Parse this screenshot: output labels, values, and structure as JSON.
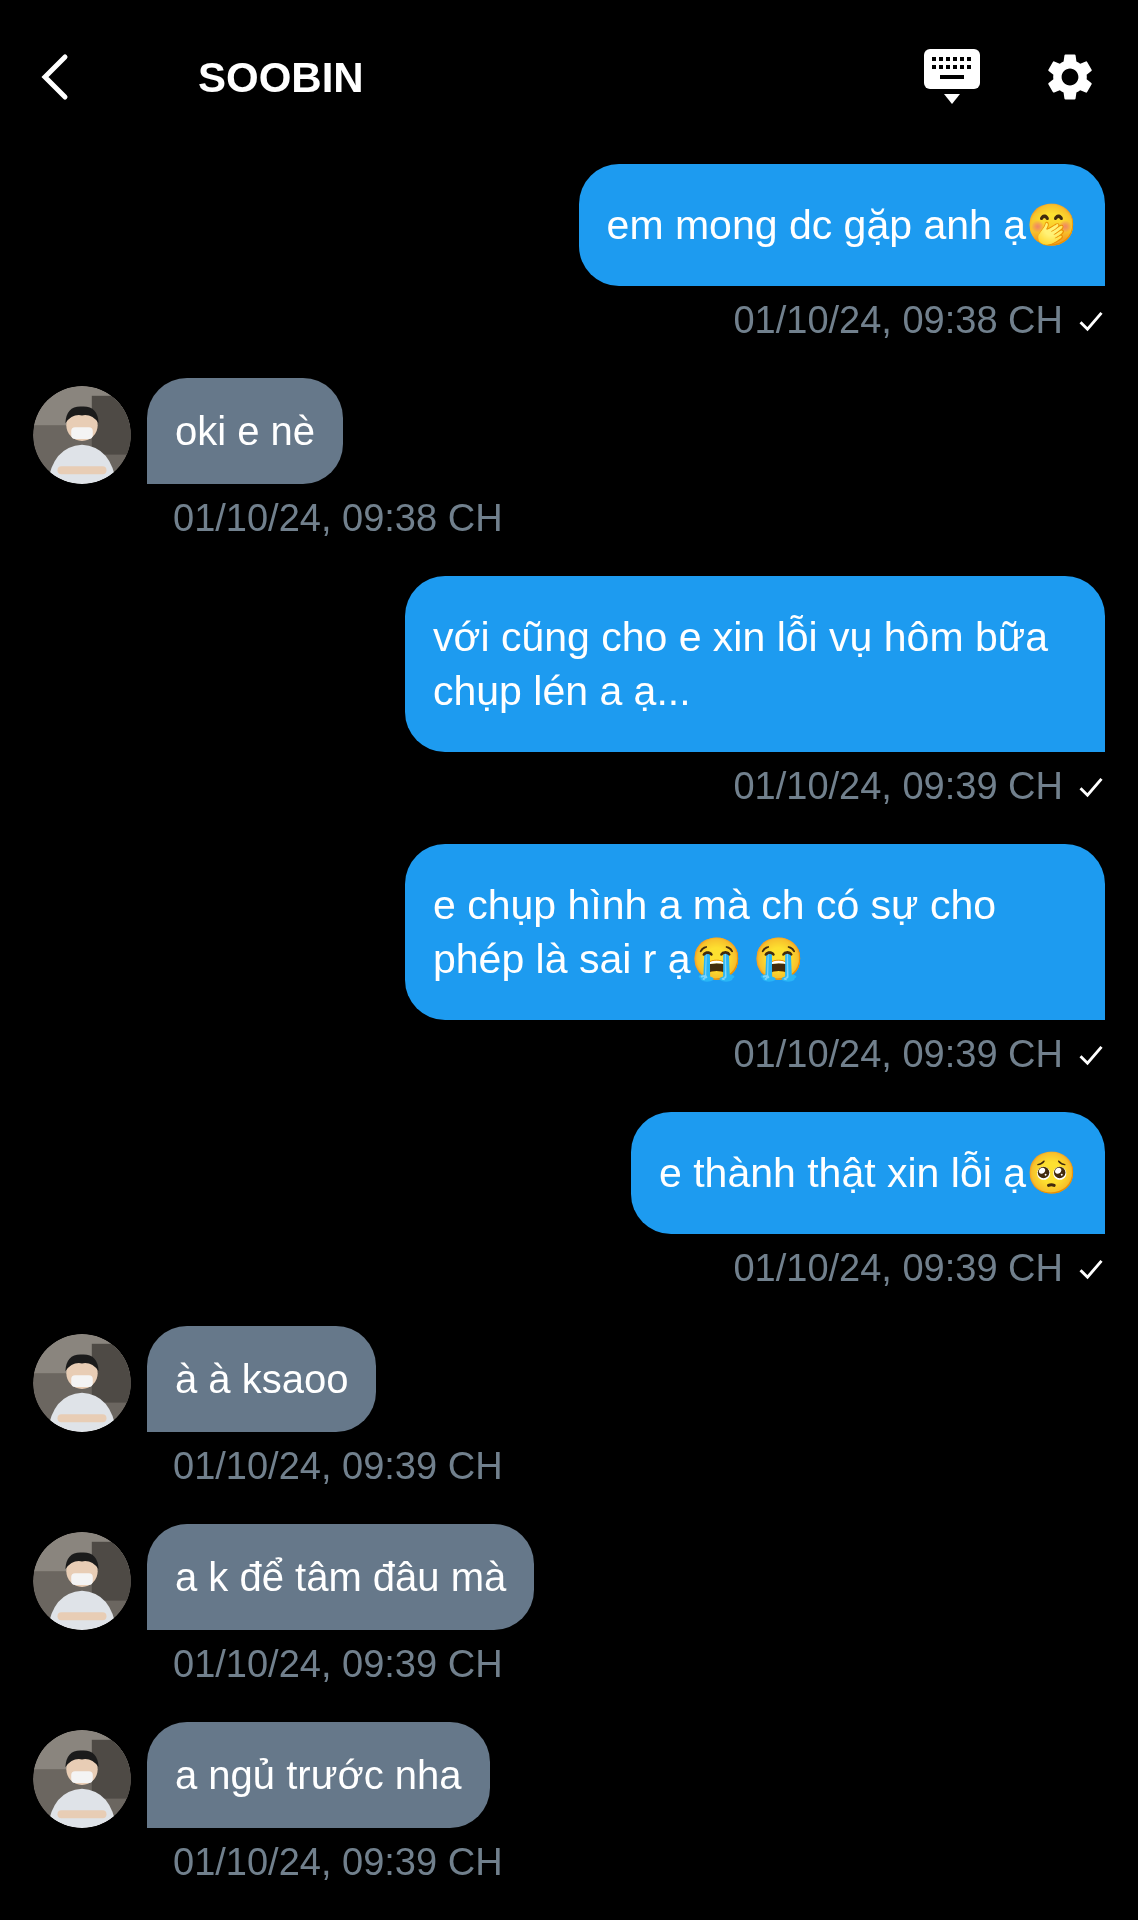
{
  "header": {
    "title": "SOOBIN"
  },
  "messages": [
    {
      "kind": "sent",
      "text": "em mong dc gặp anh ạ🤭",
      "time": "01/10/24, 09:38 CH",
      "read": true
    },
    {
      "kind": "received",
      "text": "oki e nè",
      "time": "01/10/24, 09:38 CH"
    },
    {
      "kind": "sent",
      "text": "với cũng cho e xin lỗi vụ hôm bữa chụp lén a ạ...",
      "time": "01/10/24, 09:39 CH",
      "read": true
    },
    {
      "kind": "sent",
      "text": "e chụp hình a mà ch có sự cho phép là sai r ạ😭 😭",
      "time": "01/10/24, 09:39 CH",
      "read": true
    },
    {
      "kind": "sent",
      "text": "e thành thật xin lỗi ạ🥺",
      "time": "01/10/24, 09:39 CH",
      "read": true
    },
    {
      "kind": "received",
      "text": "à à ksaoo",
      "time": "01/10/24, 09:39 CH"
    },
    {
      "kind": "received",
      "text": "a k để tâm đâu mà",
      "time": "01/10/24, 09:39 CH"
    },
    {
      "kind": "received",
      "text": "a ngủ trước nha",
      "time": "01/10/24, 09:39 CH"
    }
  ]
}
